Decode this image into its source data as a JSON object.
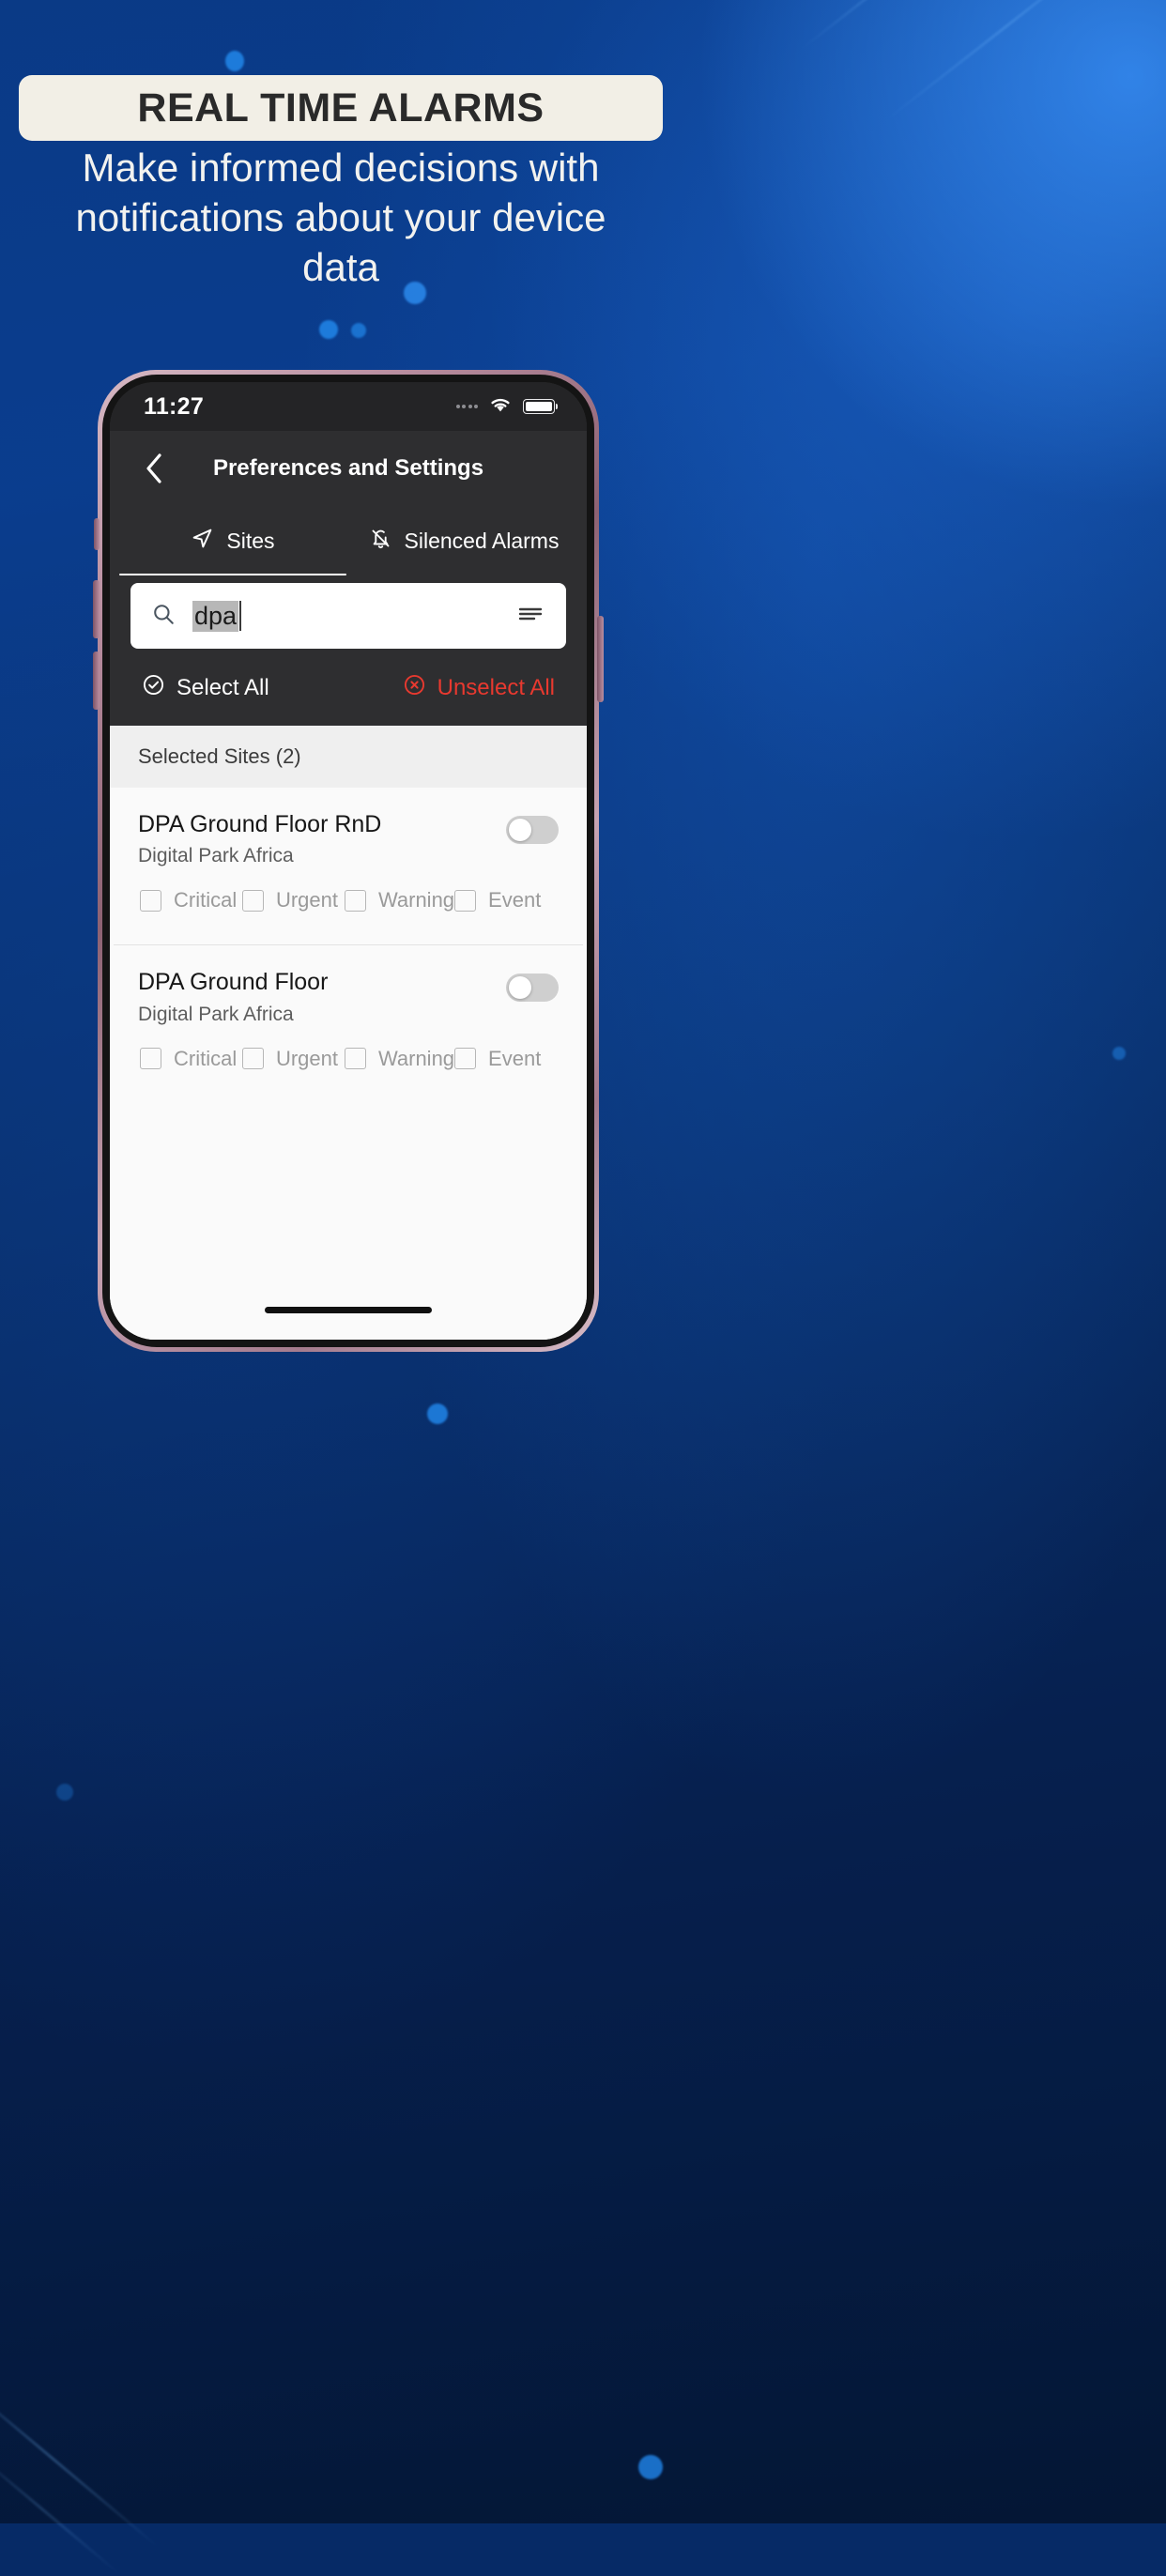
{
  "promo": {
    "headline": "REAL TIME ALARMS",
    "subheadline": "Make informed decisions with notifications about your device data",
    "pill_bg": "#f2efe6",
    "text_color": "#f2f2ef",
    "bg_color": "#0a3d8e"
  },
  "phone": {
    "status_bar": {
      "time": "11:27",
      "wifi_icon": "wifi-icon",
      "battery_icon": "battery-icon",
      "signal_icon": "signal-dots-icon"
    },
    "nav": {
      "back_icon": "chevron-left-icon",
      "title": "Preferences and Settings"
    },
    "tabs": [
      {
        "label": "Sites",
        "icon": "navigation-arrow-icon",
        "active": true
      },
      {
        "label": "Silenced Alarms",
        "icon": "bell-off-icon",
        "active": false
      }
    ],
    "search": {
      "value": "dpa",
      "placeholder": "Search",
      "search_icon": "search-icon",
      "filter_icon": "filter-lines-icon"
    },
    "actions": {
      "select_all": "Select All",
      "select_all_icon": "check-circle-icon",
      "unselect_all": "Unselect All",
      "unselect_all_icon": "x-circle-icon",
      "unselect_color": "#e8392f"
    },
    "list_header": "Selected Sites (2)",
    "severities": [
      "Critical",
      "Urgent",
      "Warning",
      "Event"
    ],
    "sites": [
      {
        "name": "DPA  Ground Floor RnD",
        "subtitle": "Digital Park Africa",
        "toggle": "off"
      },
      {
        "name": "DPA Ground Floor",
        "subtitle": "Digital Park Africa",
        "toggle": "off"
      }
    ]
  }
}
